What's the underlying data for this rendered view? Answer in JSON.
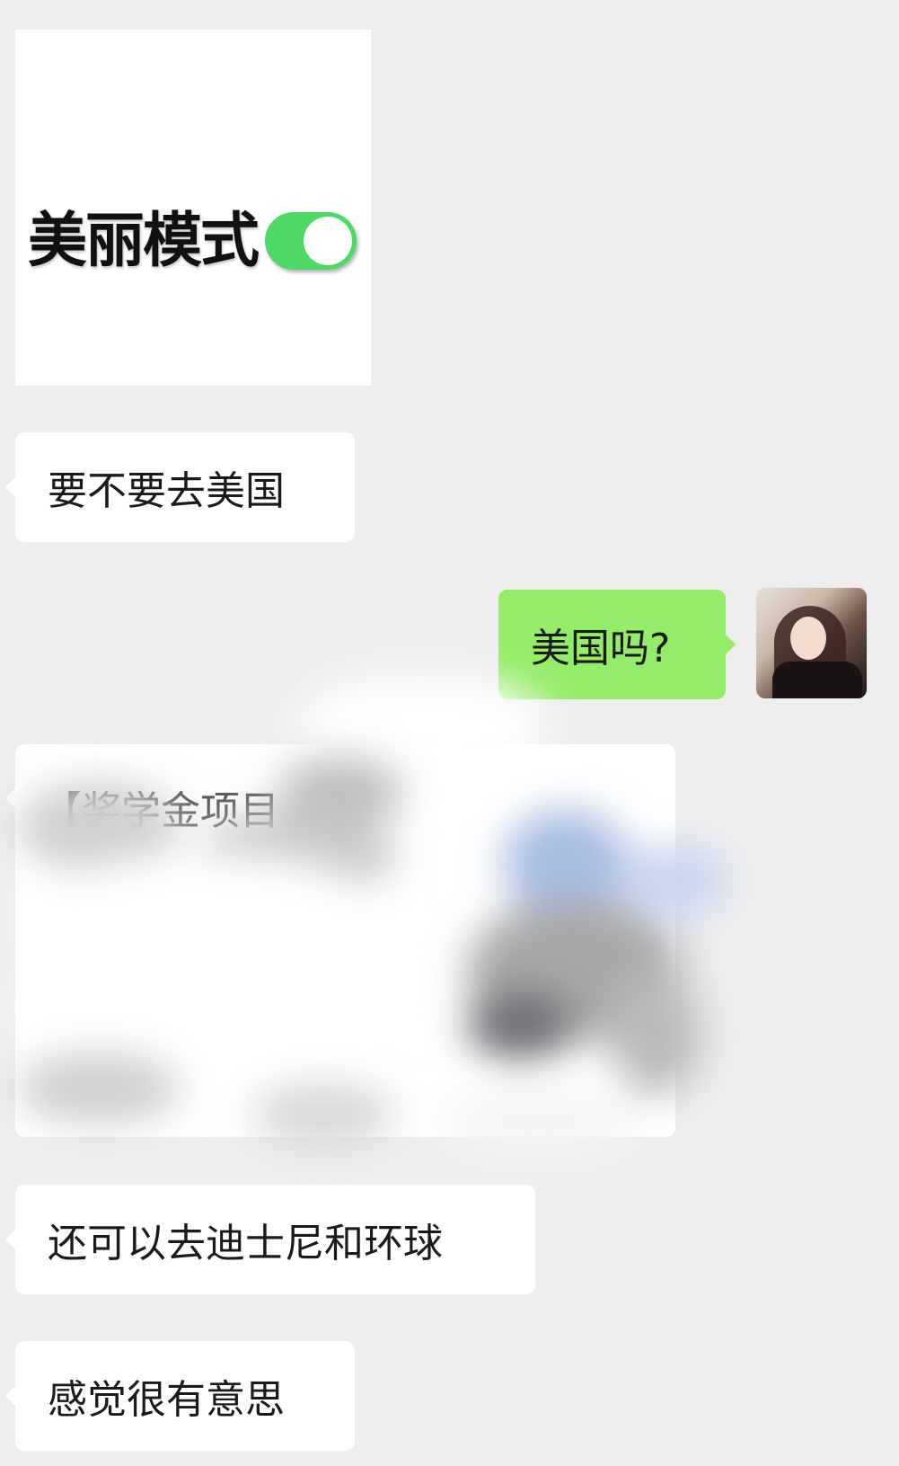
{
  "messages": {
    "sticker": {
      "text": "美丽模式",
      "toggle_on": true,
      "toggle_color": "#4cd964"
    },
    "m1": "要不要去美国",
    "m2": "美国吗?",
    "card_title": "【奖学金项目",
    "m3": "还可以去迪士尼和环球",
    "m4": "感觉很有意思"
  },
  "colors": {
    "background": "#ededed",
    "incoming_bubble": "#ffffff",
    "outgoing_bubble": "#95ec69"
  }
}
